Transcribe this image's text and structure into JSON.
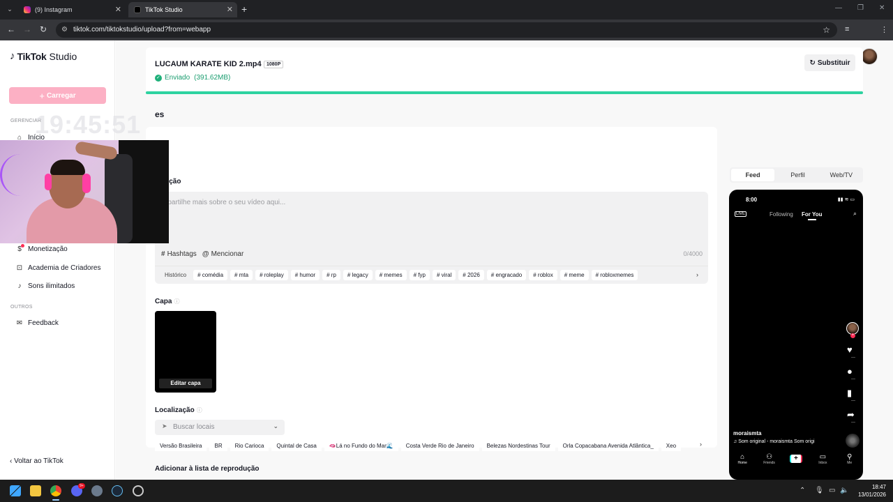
{
  "browser": {
    "tabs": [
      {
        "label": "(9) Instagram",
        "active": false
      },
      {
        "label": "TikTok Studio",
        "active": true
      }
    ],
    "url": "tiktok.com/tiktokstudio/upload?from=webapp"
  },
  "sidebar": {
    "logo_brand": "TikTok",
    "logo_product": "Studio",
    "upload_label": "Carregar",
    "section_manage": "GERENCIAR",
    "items": [
      {
        "label": "Início",
        "icon": "home-icon"
      },
      {
        "label": "Monetização",
        "icon": "dollar-icon"
      },
      {
        "label": "Academia de Criadores",
        "icon": "academy-icon"
      },
      {
        "label": "Sons ilimitados",
        "icon": "music-note-icon"
      }
    ],
    "section_others": "OUTROS",
    "feedback_label": "Feedback",
    "back_label": "Voltar ao TikTok"
  },
  "upload": {
    "file_name": "LUCAUM KARATE KID 2.mp4",
    "resolution": "1080P",
    "status": "Enviado",
    "size": "(391.62MB)",
    "replace_label": "Substituir",
    "progress": 1.0
  },
  "details": {
    "title_partial": "es",
    "description_label_partial": "crição",
    "description_placeholder": "mpartilhe mais sobre o seu vídeo aqui...",
    "hashtags_label": "Hashtags",
    "mention_label": "Mencionar",
    "char_count": "0/4000",
    "history_label": "Histórico",
    "tags": [
      "# comédia",
      "# mta",
      "# roleplay",
      "# humor",
      "# rp",
      "# legacy",
      "# memes",
      "# fyp",
      "# viral",
      "# 2026",
      "# engracado",
      "# roblox",
      "# meme",
      "# robloxmemes"
    ],
    "cover_label": "Capa",
    "cover_edit": "Editar capa",
    "location_label": "Localização",
    "location_placeholder": "Buscar locais",
    "location_chips": [
      "Versão Brasileira",
      "BR",
      "Rio Carioca",
      "Quintal de Casa",
      "🫦Lá no Fundo do Mar🌊",
      "Costa Verde Rio de Janeiro",
      "Belezas Nordestinas Tour",
      "Orla Copacabana Avenida Atlântica_",
      "Xeo"
    ],
    "playlist_label": "Adicionar à lista de reprodução"
  },
  "preview": {
    "tabs": [
      "Feed",
      "Perfil",
      "Web/TV"
    ],
    "active_tab": "Feed",
    "phone_time": "8:00",
    "live": "LIVE",
    "following": "Following",
    "for_you": "For You",
    "username": "moraismta",
    "sound": "Som original - moraismta   Som origi",
    "nav": [
      "Home",
      "Friends",
      "",
      "Inbox",
      "Me"
    ]
  },
  "overlay": {
    "clock": "19:45:51"
  },
  "taskbar": {
    "discord_badge": "9+",
    "time": "18:47",
    "date": "13/01/2026"
  },
  "colors": {
    "brand_pink": "#fe2c55",
    "upload_button": "#fcb0c4",
    "success_green": "#1a9d6f",
    "progress_teal": "#2ed3a0"
  }
}
